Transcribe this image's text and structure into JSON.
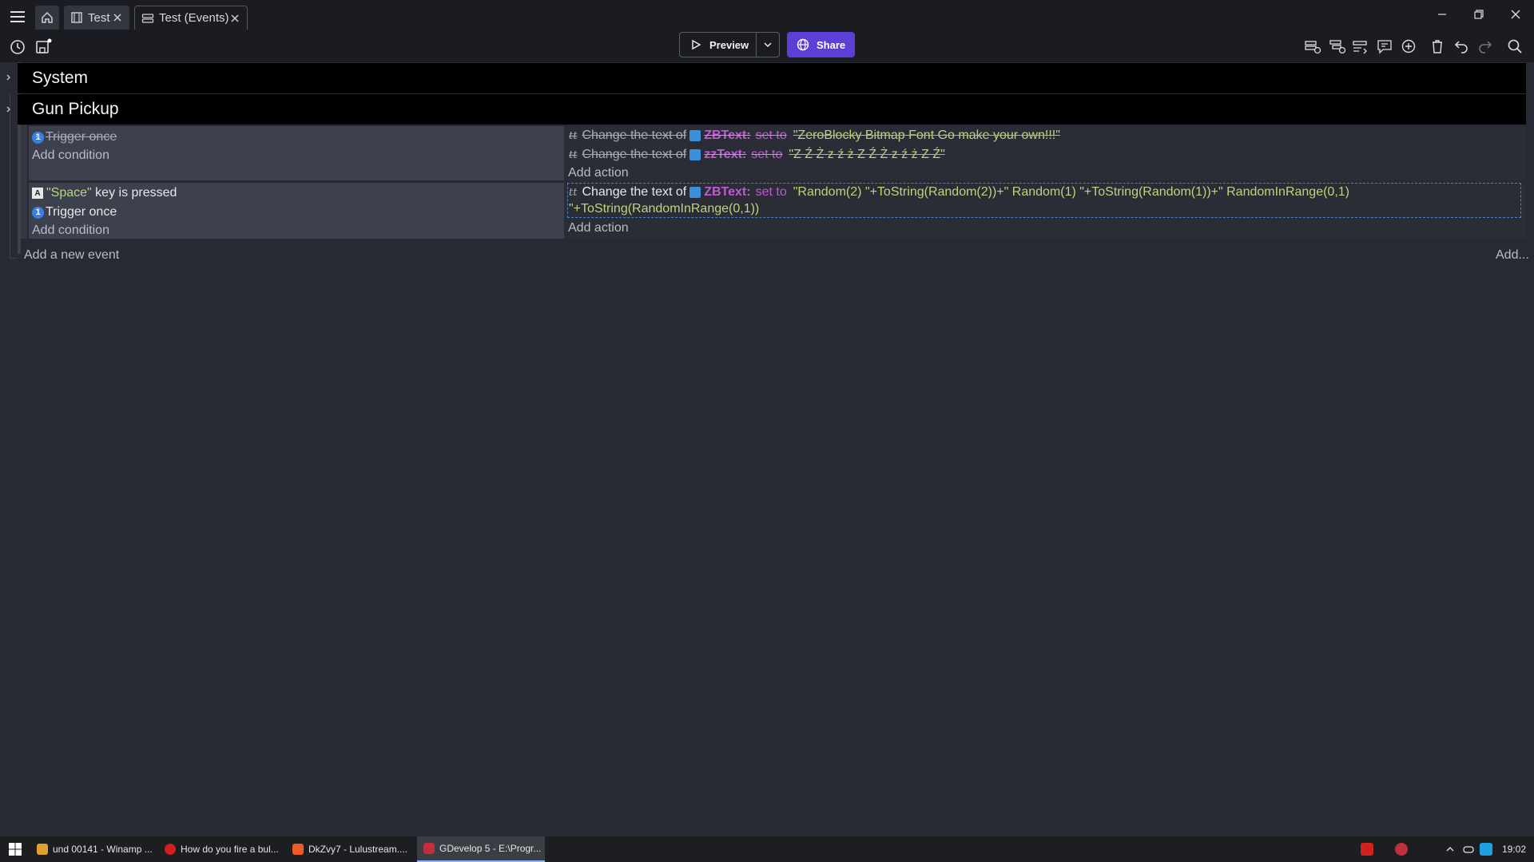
{
  "titlebar": {
    "tabs": [
      {
        "label": "Test"
      },
      {
        "label": "Test (Events)"
      }
    ]
  },
  "toolbar": {
    "preview_label": "Preview",
    "share_label": "Share",
    "accent_color": "#5c3fd6"
  },
  "events": {
    "groups": [
      {
        "title": "System"
      },
      {
        "title": "Gun Pickup"
      }
    ],
    "event1": {
      "conditions": [
        {
          "icon": "1",
          "text": "Trigger once",
          "disabled": true
        }
      ],
      "add_condition": "Add condition",
      "actions": [
        {
          "prefix": "Change the text of",
          "object": "ZBText:",
          "verb": "set to",
          "value": "\"ZeroBlocky Bitmap Font Go make your own!!!\"",
          "disabled": true
        },
        {
          "prefix": "Change the text of",
          "object": "zzText:",
          "verb": "set to",
          "value": "\"Z Ź Ż z ź ż Z Ź Ż z ź ż Z Ź\"",
          "disabled": true
        }
      ],
      "add_action": "Add action"
    },
    "event2": {
      "conditions": [
        {
          "key": "\"Space\"",
          "text": " key is pressed"
        },
        {
          "icon": "1",
          "text": "Trigger once"
        }
      ],
      "add_condition": "Add condition",
      "action": {
        "prefix": "Change the text of",
        "object": "ZBText:",
        "verb": "set to",
        "value_line1": "\"Random(2) \"+ToString(Random(2))+\" Random(1) \"+ToString(Random(1))+\" RandomInRange(0,1)",
        "value_line2": "\"+ToString(RandomInRange(0,1))"
      },
      "add_action": "Add action"
    },
    "add_event": "Add a new event",
    "add_more": "Add..."
  },
  "taskbar": {
    "items": [
      {
        "label": "und 00141 - Winamp ..."
      },
      {
        "label": "How do you fire a bul..."
      },
      {
        "label": "DkZvy7 - Lulustream...."
      },
      {
        "label": "GDevelop 5 - E:\\Progr..."
      }
    ],
    "clock": "19:02"
  }
}
